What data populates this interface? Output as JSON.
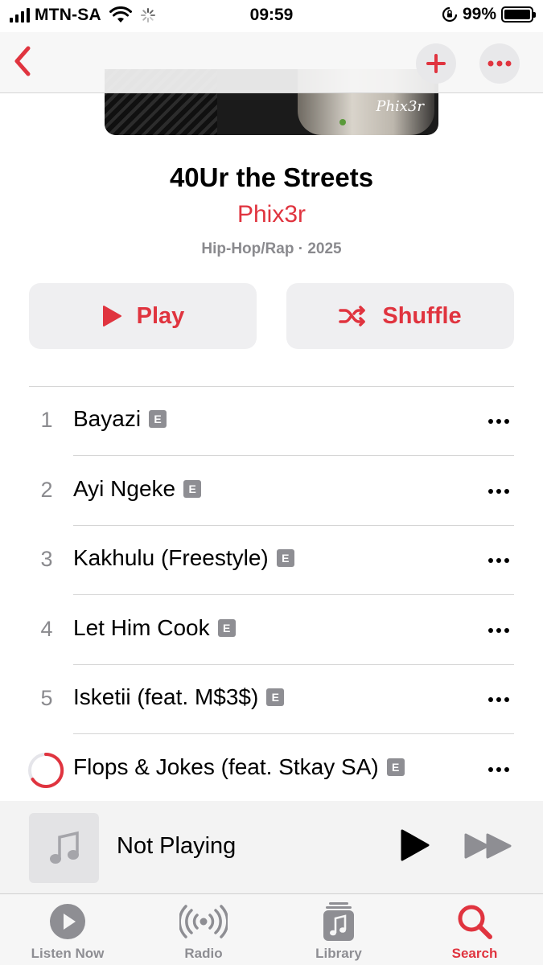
{
  "status_bar": {
    "carrier": "MTN-SA",
    "time": "09:59",
    "battery": "99%",
    "battery_level": 0.99
  },
  "nav": {
    "back_icon": "chevron-left-icon",
    "add_icon": "plus-icon",
    "more_icon": "ellipsis-icon",
    "accent": "#e0343f"
  },
  "artwork": {
    "signature": "Phix3r"
  },
  "album": {
    "title": "40Ur the Streets",
    "artist": "Phix3r",
    "meta": "Hip-Hop/Rap · 2025"
  },
  "actions": {
    "play_label": "Play",
    "shuffle_label": "Shuffle"
  },
  "tracks": [
    {
      "number": "1",
      "title": "Bayazi",
      "explicit": "E"
    },
    {
      "number": "2",
      "title": "Ayi Ngeke",
      "explicit": "E"
    },
    {
      "number": "3",
      "title": "Kakhulu (Freestyle)",
      "explicit": "E"
    },
    {
      "number": "4",
      "title": "Let Him Cook",
      "explicit": "E"
    },
    {
      "number": "5",
      "title": "Isketii (feat. M$3$)",
      "explicit": "E"
    },
    {
      "number": "",
      "title": "Flops & Jokes (feat. Stkay SA)",
      "explicit": "E",
      "status": "loading"
    }
  ],
  "mini_player": {
    "label": "Not Playing"
  },
  "tabs": [
    {
      "label": "Listen Now",
      "icon": "play-circle-icon",
      "active": false
    },
    {
      "label": "Radio",
      "icon": "radio-waves-icon",
      "active": false
    },
    {
      "label": "Library",
      "icon": "library-icon",
      "active": false
    },
    {
      "label": "Search",
      "icon": "search-icon",
      "active": true
    }
  ]
}
